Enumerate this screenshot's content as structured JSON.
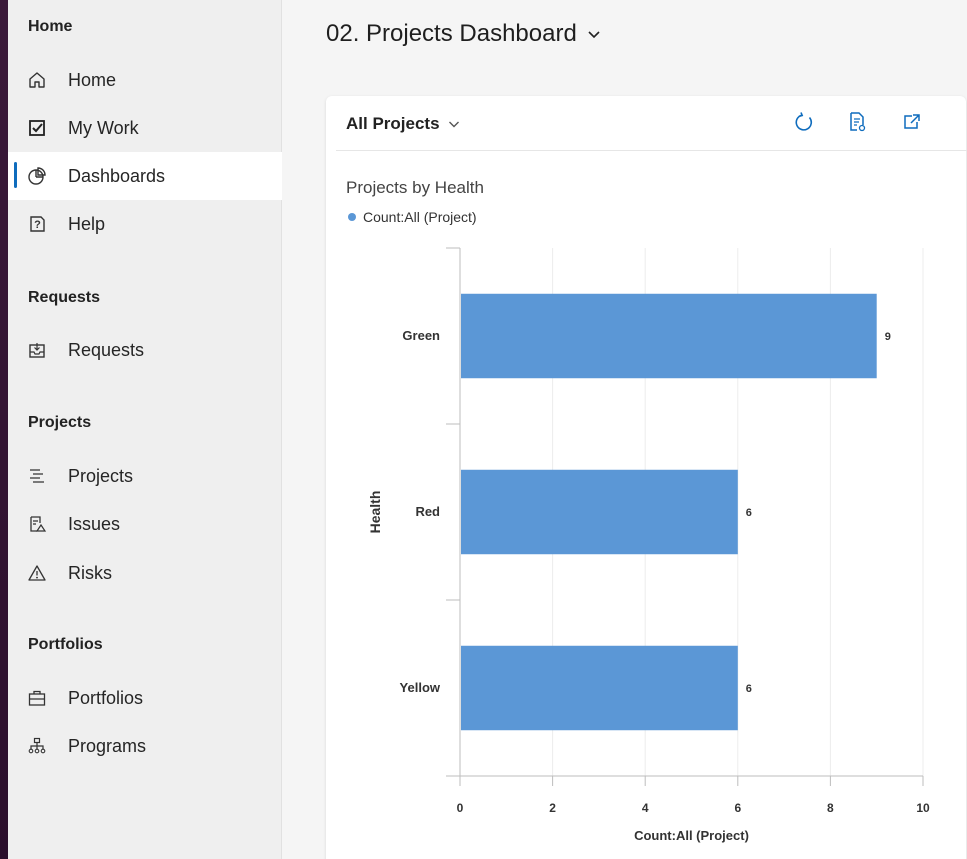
{
  "sidebar": {
    "sections": {
      "home": "Home",
      "requests": "Requests",
      "projects": "Projects",
      "portfolios": "Portfolios"
    },
    "items": {
      "home": "Home",
      "my_work": "My Work",
      "dashboards": "Dashboards",
      "help": "Help",
      "requests": "Requests",
      "projects": "Projects",
      "issues": "Issues",
      "risks": "Risks",
      "portfolios": "Portfolios",
      "programs": "Programs"
    },
    "active_item": "Dashboards"
  },
  "header": {
    "title": "02. Projects Dashboard"
  },
  "card": {
    "filter_label": "All Projects",
    "tools": [
      "refresh-icon",
      "report-icon",
      "popout-icon"
    ]
  },
  "colors": {
    "accent": "#0f6cbd",
    "bar": "#5b97d6"
  },
  "chart_data": {
    "type": "bar",
    "orientation": "horizontal",
    "title": "Projects by Health",
    "legend": [
      "Count:All (Project)"
    ],
    "legend_position": "top-left",
    "categories": [
      "Green",
      "Red",
      "Yellow"
    ],
    "values": [
      9,
      6,
      6
    ],
    "data_labels": [
      "9",
      "6",
      "6"
    ],
    "xlabel": "Count:All (Project)",
    "ylabel": "Health",
    "xlim": [
      0,
      10
    ],
    "x_ticks": [
      "0",
      "2",
      "4",
      "6",
      "8",
      "10"
    ],
    "grid": true
  }
}
